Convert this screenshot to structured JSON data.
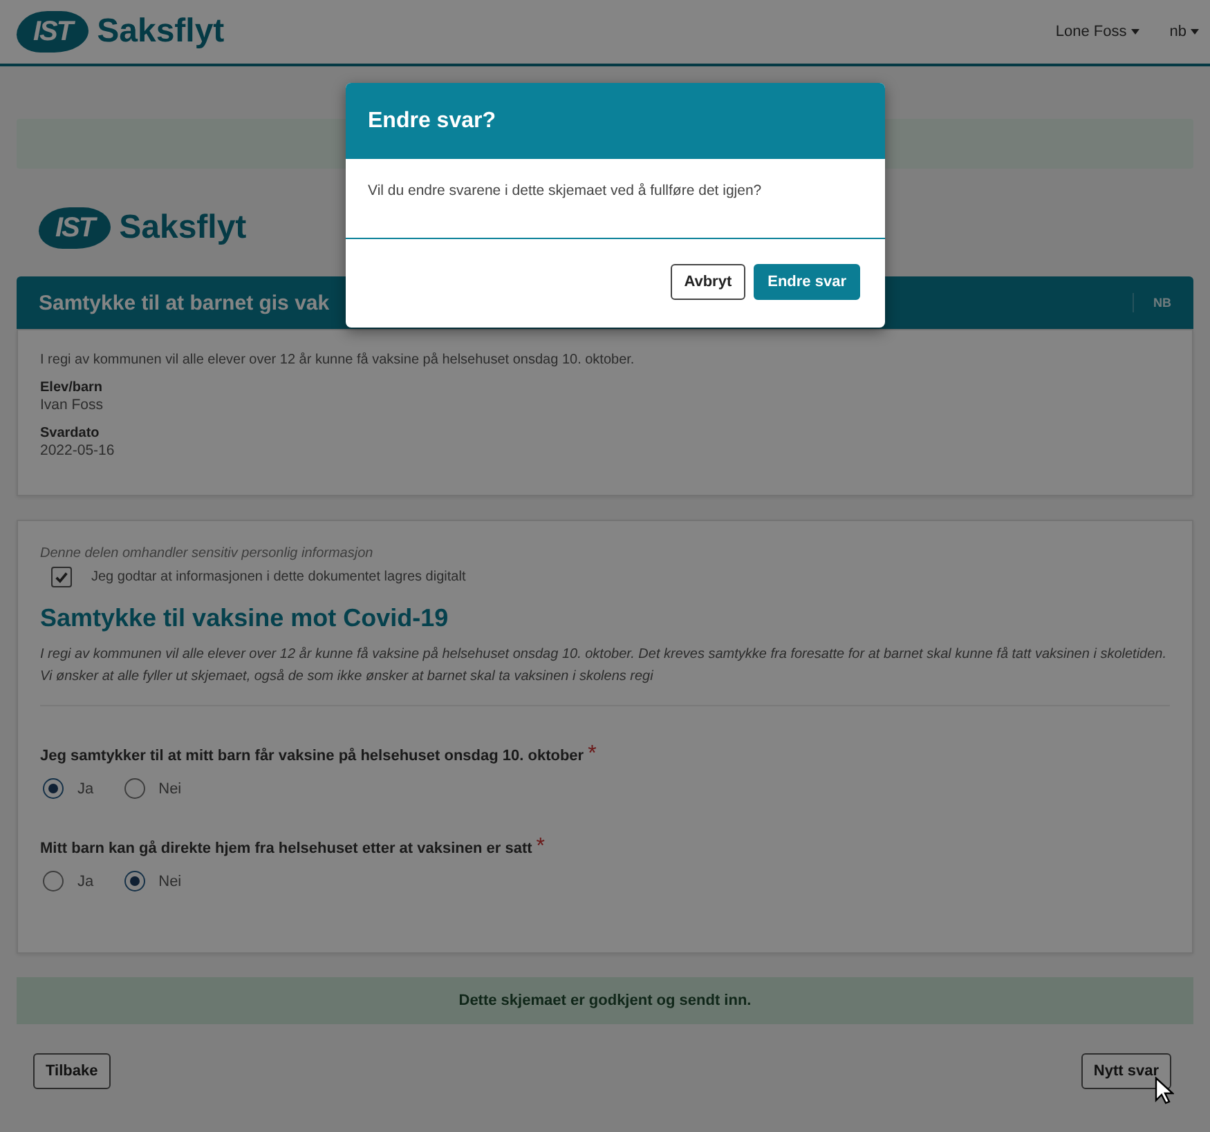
{
  "header": {
    "logo": {
      "mark": "IST",
      "name": "Saksflyt"
    },
    "user_menu": "Lone Foss",
    "language_menu": "nb"
  },
  "form": {
    "logo": {
      "mark": "IST",
      "name": "Saksflyt"
    },
    "title": "Samtykke til at barnet gis vak",
    "badge": "NB",
    "intro": "I regi av kommunen vil alle elever over 12 år kunne få vaksine på helsehuset onsdag 10. oktober.",
    "fields": [
      {
        "label": "Elev/barn",
        "value": "Ivan Foss"
      },
      {
        "label": "Svardato",
        "value": "2022-05-16"
      }
    ]
  },
  "section": {
    "notice": "Denne delen omhandler sensitiv personlig informasjon",
    "consent": {
      "label": "Jeg godtar at informasjonen i dette dokumentet lagres digitalt",
      "checked": true
    },
    "heading": "Samtykke til vaksine mot Covid-19",
    "description": "I regi av kommunen vil alle elever over 12 år kunne få vaksine på helsehuset onsdag 10. oktober. Det kreves samtykke fra foresatte for at barnet skal kunne få tatt vaksinen i skoletiden. Vi ønsker at alle fyller ut skjemaet, også de som ikke ønsker at barnet skal ta vaksinen i skolens regi",
    "questions": [
      {
        "label": "Jeg samtykker til at mitt barn får vaksine på helsehuset onsdag 10. oktober",
        "required_mark": "*",
        "options": [
          {
            "label": "Ja",
            "selected": true
          },
          {
            "label": "Nei",
            "selected": false
          }
        ]
      },
      {
        "label": "Mitt barn kan gå direkte hjem fra helsehuset etter at vaksinen er satt",
        "required_mark": "*",
        "options": [
          {
            "label": "Ja",
            "selected": false
          },
          {
            "label": "Nei",
            "selected": true
          }
        ]
      }
    ]
  },
  "status_message": "Dette skjemaet er godkjent og sendt inn.",
  "actions": [
    {
      "label": "Tilbake"
    },
    {
      "label": "Nytt svar"
    }
  ],
  "dialog": {
    "title": "Endre svar?",
    "message": "Vil du endre svarene i dette skjemaet ved å fullføre det igjen?",
    "buttons": [
      {
        "label": "Avbryt",
        "kind": "secondary"
      },
      {
        "label": "Endre svar",
        "kind": "primary"
      }
    ]
  }
}
